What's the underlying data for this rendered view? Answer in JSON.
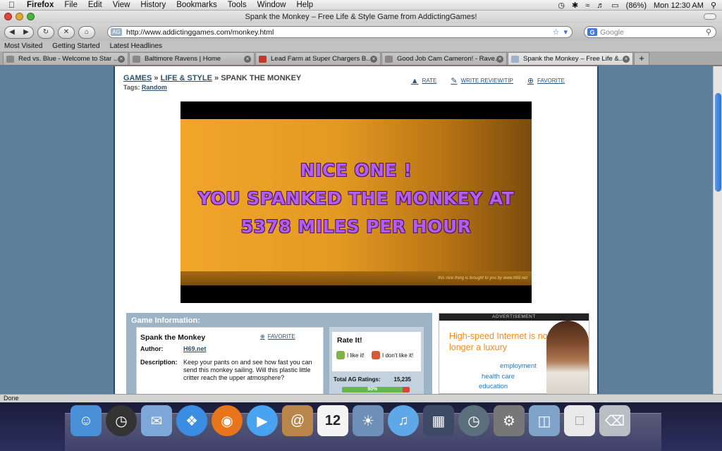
{
  "menubar": {
    "app": "Firefox",
    "items": [
      "File",
      "Edit",
      "View",
      "History",
      "Bookmarks",
      "Tools",
      "Window",
      "Help"
    ],
    "battery": "(86%)",
    "clock": "Mon 12:30 AM"
  },
  "window": {
    "title": "Spank the Monkey – Free Life & Style Game from AddictingGames!"
  },
  "navbar": {
    "url": "http://www.addictinggames.com/monkey.html",
    "favicon": "AG",
    "search_placeholder": "Google"
  },
  "bookmarks": [
    "Most Visited",
    "Getting Started",
    "Latest Headlines"
  ],
  "tabs": [
    {
      "title": "Red vs. Blue - Welcome to Star ...",
      "active": false
    },
    {
      "title": "Baltimore Ravens | Home",
      "active": false
    },
    {
      "title": "Lead Farm at Super Chargers B...",
      "active": false
    },
    {
      "title": "Good Job Cam Cameron! - Rave...",
      "active": false
    },
    {
      "title": "Spank the Monkey – Free Life &...",
      "active": true
    }
  ],
  "page": {
    "crumb_games": "GAMES",
    "crumb_sep": "»",
    "crumb_category": "LIFE & STYLE",
    "crumb_current": "SPANK THE MONKEY",
    "tags_label": "Tags:",
    "tag_random": "Random",
    "action_rate": "RATE",
    "action_review": "WRITE REVIEW/TIP",
    "action_favorite": "FAVORITE"
  },
  "game": {
    "line1": "NICE ONE !",
    "line2": "YOU SPANKED THE MONKEY AT",
    "line3": "5378 MILES PER HOUR",
    "credit": "this nice thing is brought to you by www.h69.net"
  },
  "info": {
    "section_title": "Game Information:",
    "name": "Spank the Monkey",
    "favorite": "FAVORITE",
    "author_label": "Author:",
    "author": "H69.net",
    "description_label": "Description:",
    "description": "Keep your pants on and see how fast you can send this monkey sailing. Will this plastic little critter reach the upper atmosphere?"
  },
  "rating": {
    "title": "Rate It!",
    "like": "I like it!",
    "dislike": "I don't like it!",
    "total_label": "Total AG Ratings:",
    "total": "15,235",
    "percent": "90%",
    "percent_value": 90
  },
  "ad": {
    "label": "ADVERTISEMENT",
    "headline": "High-speed Internet is no longer a luxury",
    "words": [
      "employment",
      "health care",
      "education"
    ]
  },
  "status": "Done",
  "dock": [
    "Finder",
    "Dashboard",
    "Mail",
    "Safari",
    "Firefox",
    "iChat",
    "Address Book",
    "iCal",
    "iPhoto",
    "iTunes",
    "Spaces",
    "Time Machine",
    "System Preferences",
    "Applications",
    "Documents",
    "Trash"
  ],
  "colors": {
    "page_bg": "#5d7f9c",
    "link": "#2c5272",
    "ad_orange": "#f08a1c",
    "game_text": "#b25cf0"
  }
}
